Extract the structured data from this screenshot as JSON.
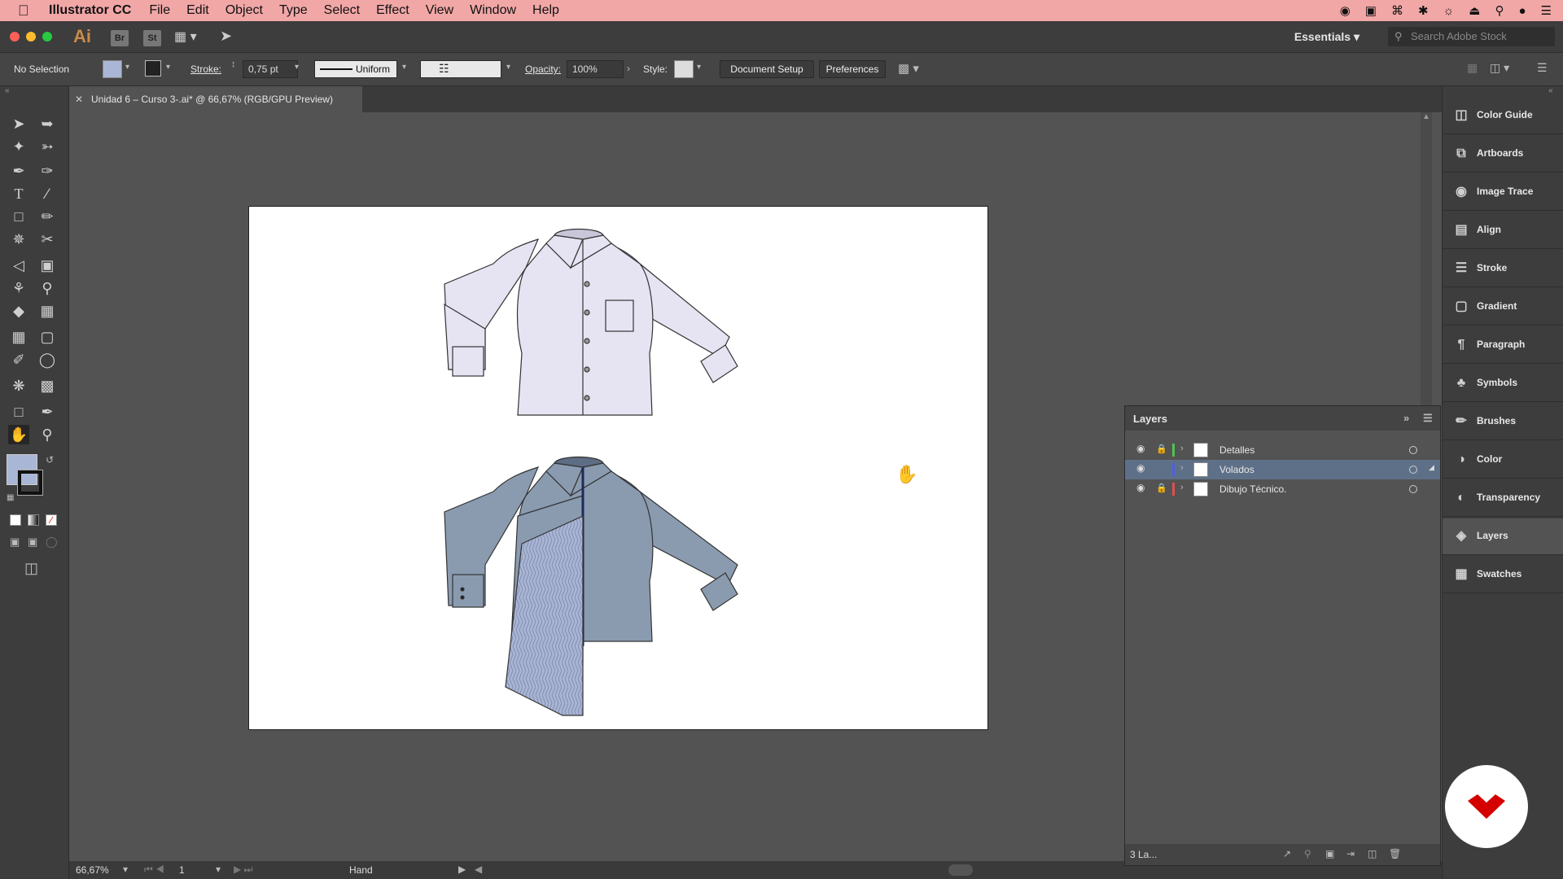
{
  "menubar": {
    "app_name": "Illustrator CC",
    "items": [
      "File",
      "Edit",
      "Object",
      "Type",
      "Select",
      "Effect",
      "View",
      "Window",
      "Help"
    ]
  },
  "appbar": {
    "logo": "Ai",
    "bridge": "Br",
    "stock": "St",
    "workspace": "Essentials",
    "search_placeholder": "Search Adobe Stock"
  },
  "control": {
    "selection": "No Selection",
    "stroke_label": "Stroke:",
    "stroke_value": "0,75 pt",
    "profile": "Uniform",
    "opacity_label": "Opacity:",
    "opacity_value": "100%",
    "style_label": "Style:",
    "doc_setup": "Document Setup",
    "preferences": "Preferences"
  },
  "document": {
    "tab_title": "Unidad 6 – Curso 3-.ai* @ 66,67% (RGB/GPU Preview)"
  },
  "status": {
    "zoom": "66,67%",
    "artboard": "1",
    "tool": "Hand"
  },
  "dock": {
    "items": [
      "Color Guide",
      "Artboards",
      "Image Trace",
      "Align",
      "Stroke",
      "Gradient",
      "Paragraph",
      "Symbols",
      "Brushes",
      "Color",
      "Transparency",
      "Layers",
      "Swatches"
    ]
  },
  "layers": {
    "title": "Layers",
    "rows": [
      {
        "name": "Detalles",
        "color": "#4fc34f"
      },
      {
        "name": "Volados",
        "color": "#4f5fe0"
      },
      {
        "name": "Dibujo Técnico.",
        "color": "#e04f4f"
      }
    ],
    "count": "3 La..."
  },
  "colors": {
    "shirt_top": "#e6e4f3",
    "shirt_bottom": "#8a9bb0",
    "ruffle": "#a9b5d3",
    "accent_logo": "#d40000"
  }
}
